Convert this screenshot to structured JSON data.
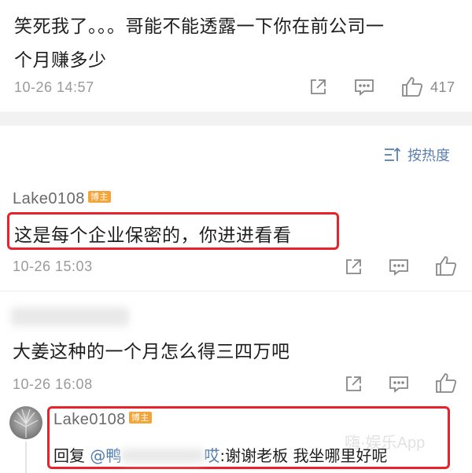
{
  "comment1": {
    "text_line1": "笑死我了。。。哥能不能透露一下你在前公司一",
    "text_line2": "个月赚多少",
    "timestamp": "10-26 14:57",
    "like_count": "417"
  },
  "sort": {
    "label": "按热度"
  },
  "comment2": {
    "username": "Lake0108",
    "badge": "博主",
    "text": "这是每个企业保密的，你进进看看",
    "timestamp": "10-26 15:03"
  },
  "comment3": {
    "text": "大姜这种的一个月怎么得三四万吧",
    "timestamp": "10-26 16:08"
  },
  "reply": {
    "username": "Lake0108",
    "badge": "博主",
    "prefix": "回复",
    "mention": "@鸭",
    "mention_tail": "哎",
    "text": ":谢谢老板 我坐哪里好呢"
  },
  "watermark": "嗨·娱乐App",
  "colors": {
    "highlight": "#e8232c",
    "badge": "#f3a53a",
    "link": "#507daf"
  }
}
